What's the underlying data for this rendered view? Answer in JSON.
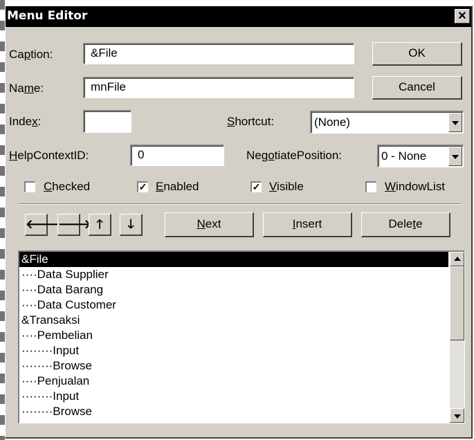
{
  "window": {
    "title": "Menu Editor",
    "close_glyph": "✕"
  },
  "caption": {
    "label_pre": "Ca",
    "label_u": "p",
    "label_post": "tion:",
    "value": "&File"
  },
  "name": {
    "label_pre": "Na",
    "label_u": "m",
    "label_post": "e:",
    "value": "mnFile"
  },
  "index": {
    "label_pre": "Inde",
    "label_u": "x",
    "label_post": ":",
    "value": ""
  },
  "shortcut": {
    "label_u": "S",
    "label_post": "hortcut:",
    "value": "(None)"
  },
  "help_context": {
    "label_u": "H",
    "label_post": "elpContextID:",
    "value": "0"
  },
  "negotiate": {
    "label_pre": "Neg",
    "label_u": "o",
    "label_post": "tiatePosition:",
    "value": "0 - None"
  },
  "checkboxes": {
    "checked": {
      "label_u": "C",
      "label_post": "hecked",
      "value": false
    },
    "enabled": {
      "label_u": "E",
      "label_post": "nabled",
      "value": true
    },
    "visible": {
      "label_u": "V",
      "label_post": "isible",
      "value": true
    },
    "windowlist": {
      "label_u": "W",
      "label_post": "indowList",
      "value": false
    }
  },
  "buttons": {
    "ok": "OK",
    "cancel": "Cancel",
    "next": {
      "u": "N",
      "post": "ext"
    },
    "insert": {
      "u": "I",
      "post": "nsert"
    },
    "delete": {
      "pre": "Dele",
      "u": "t",
      "post": "e"
    }
  },
  "arrows": {
    "left": "🡐",
    "right": "🡒",
    "up": "🡑",
    "down": "🡓"
  },
  "menu_list": {
    "selected_index": 0,
    "items": [
      "&File",
      "····Data Supplier",
      "····Data Barang",
      "····Data Customer",
      "&Transaksi",
      "····Pembelian",
      "········Input",
      "········Browse",
      "····Penjualan",
      "········Input",
      "········Browse"
    ]
  },
  "icons": {
    "close": "close-icon",
    "dropdown": "chevron-down-icon",
    "scroll_up": "scroll-up-icon",
    "scroll_down": "scroll-down-icon",
    "check": "check-icon"
  }
}
